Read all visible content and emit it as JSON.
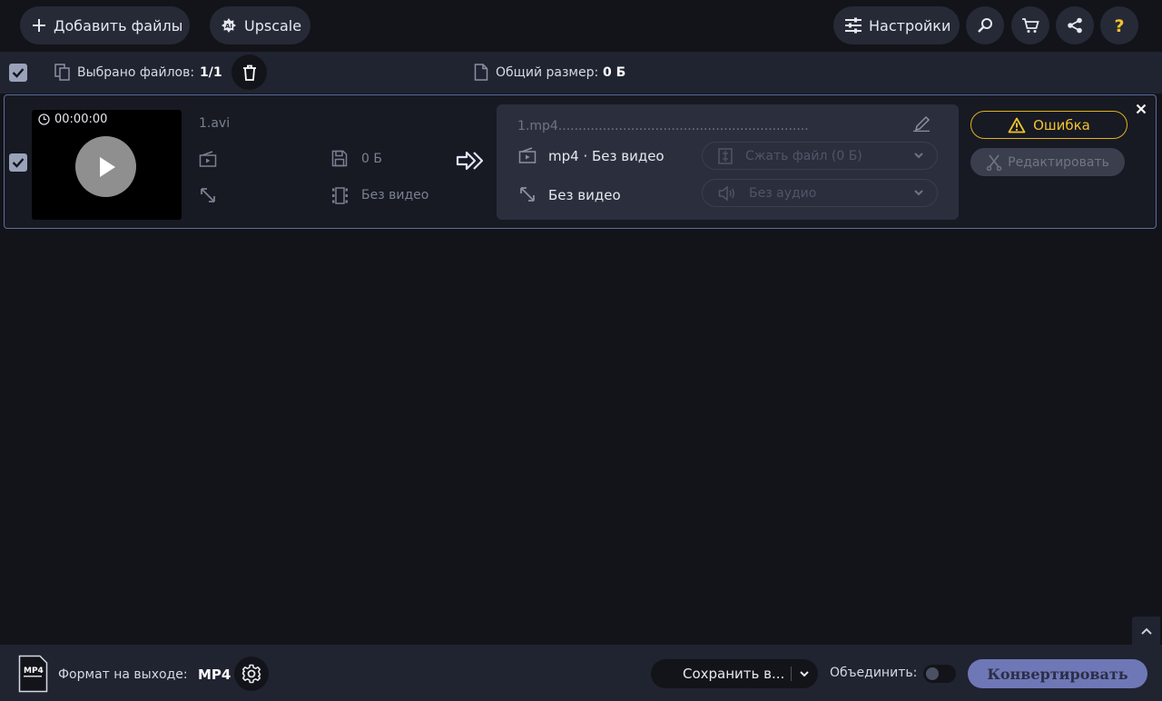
{
  "toolbar": {
    "add_files_label": "Добавить файлы",
    "upscale_label": "Upscale",
    "settings_label": "Настройки"
  },
  "selection": {
    "selected_label": "Выбрано файлов:",
    "selected_value": "1/1",
    "total_size_label": "Общий размер:",
    "total_size_value": "0 Б"
  },
  "file": {
    "duration": "00:00:00",
    "name": "1.avi",
    "size": "0 Б",
    "video": "Без видео",
    "output_name": "1.mp4..............................................................",
    "output_format": "mp4 · Без видео",
    "output_resolution": "Без видео",
    "compress_label": "Сжать файл (0 Б)",
    "audio_label": "Без аудио",
    "error_label": "Ошибка",
    "edit_label": "Редактировать"
  },
  "bottom": {
    "format_label": "Формат на выходе:",
    "format_value": "MP4",
    "format_icon_text": "MP4",
    "save_label": "Сохранить в...",
    "merge_label": "Объединить:",
    "convert_label": "Конвертировать"
  },
  "colors": {
    "background": "#131419",
    "panel": "#202431",
    "pill": "#262a37",
    "accent": "#6f78b6",
    "error": "#f2c12e"
  }
}
